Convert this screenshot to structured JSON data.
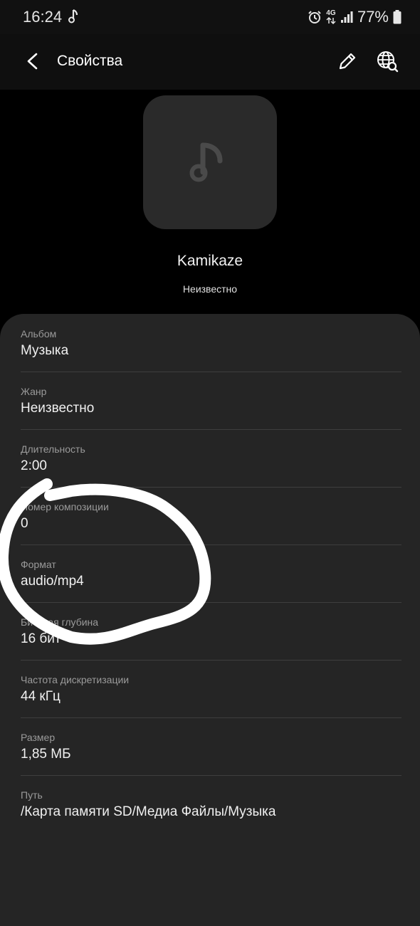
{
  "status_bar": {
    "time": "16:24",
    "network": "4G",
    "battery": "77%"
  },
  "header": {
    "title": "Свойства"
  },
  "track": {
    "title": "Kamikaze",
    "artist": "Неизвестно"
  },
  "details": [
    {
      "label": "Альбом",
      "value": "Музыка"
    },
    {
      "label": "Жанр",
      "value": "Неизвестно"
    },
    {
      "label": "Длительность",
      "value": "2:00"
    },
    {
      "label": "Номер композиции",
      "value": "0"
    },
    {
      "label": "Формат",
      "value": "audio/mp4"
    },
    {
      "label": "Битовая глубина",
      "value": "16 бит"
    },
    {
      "label": "Частота дискретизации",
      "value": "44 кГц"
    },
    {
      "label": "Размер",
      "value": "1,85 МБ"
    },
    {
      "label": "Путь",
      "value": "/Карта памяти SD/Медиа Файлы/Музыка"
    }
  ]
}
